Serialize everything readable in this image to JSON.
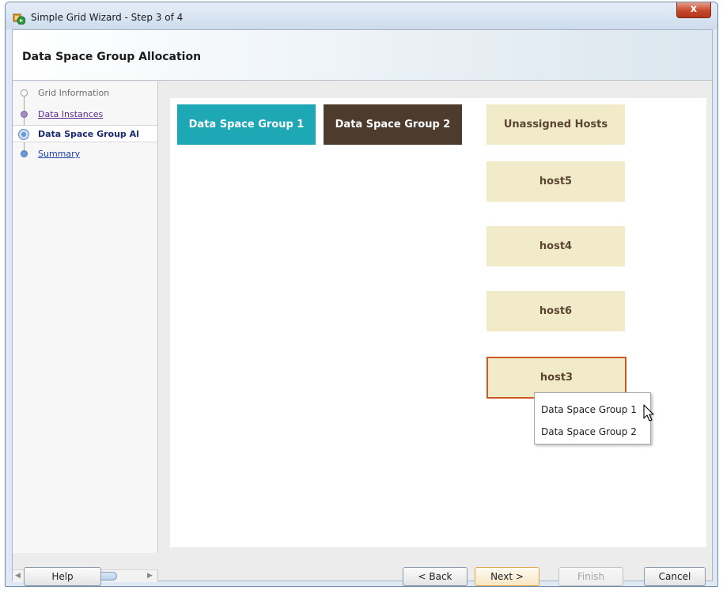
{
  "window": {
    "title": "Simple Grid Wizard - Step 3 of 4",
    "close_glyph": "x"
  },
  "header": {
    "title": "Data Space Group Allocation"
  },
  "steps": [
    {
      "label": "Grid Information",
      "state": "done"
    },
    {
      "label": "Data Instances",
      "state": "visited"
    },
    {
      "label": "Data Space Group Al",
      "state": "current"
    },
    {
      "label": "Summary",
      "state": "link"
    }
  ],
  "groups": [
    {
      "label": "Data Space Group 1",
      "color": "#1ea7b4"
    },
    {
      "label": "Data Space Group 2",
      "color": "#4d3b2e"
    }
  ],
  "unassigned": {
    "header": "Unassigned Hosts",
    "hosts": [
      "host5",
      "host4",
      "host6",
      "host3"
    ],
    "selected": "host3"
  },
  "context_menu": {
    "items": [
      "Data Space Group 1",
      "Data Space Group 2"
    ]
  },
  "buttons": {
    "help": "Help",
    "back": "< Back",
    "next": "Next >",
    "finish": "Finish",
    "cancel": "Cancel"
  },
  "colors": {
    "host_tile": "#f1ebca",
    "host_text": "#5a4530",
    "selection_border": "#cd5a26"
  }
}
